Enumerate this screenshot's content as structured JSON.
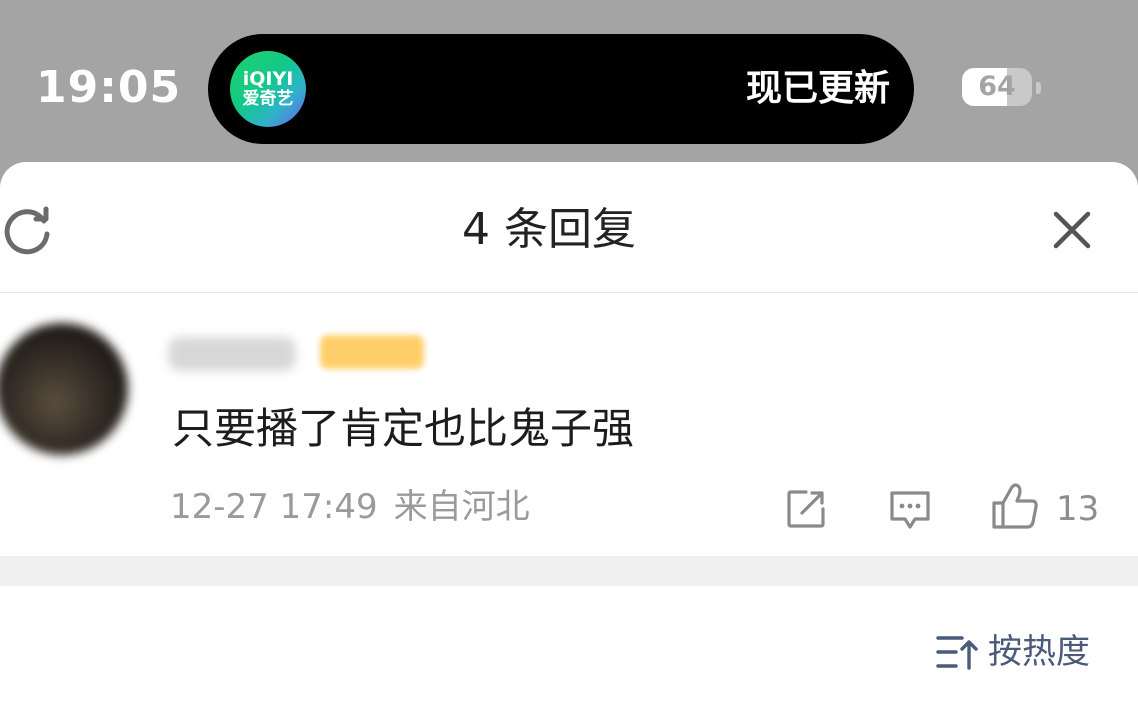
{
  "status_bar": {
    "time": "19:05",
    "battery_level": "64",
    "island": {
      "app_logo_line1": "iQIYI",
      "app_logo_line2": "爱奇艺",
      "message": "现已更新"
    }
  },
  "sheet": {
    "title": "4 条回复"
  },
  "comment": {
    "text": "只要播了肯定也比鬼子强",
    "time": "12-27 17:49",
    "location": "来自河北",
    "like_count": "13"
  },
  "sort": {
    "label": "按热度"
  },
  "colors": {
    "status_bar_bg": "#a4a4a4",
    "sheet_bg": "#ffffff",
    "sort_accent": "#4a5a7a"
  }
}
